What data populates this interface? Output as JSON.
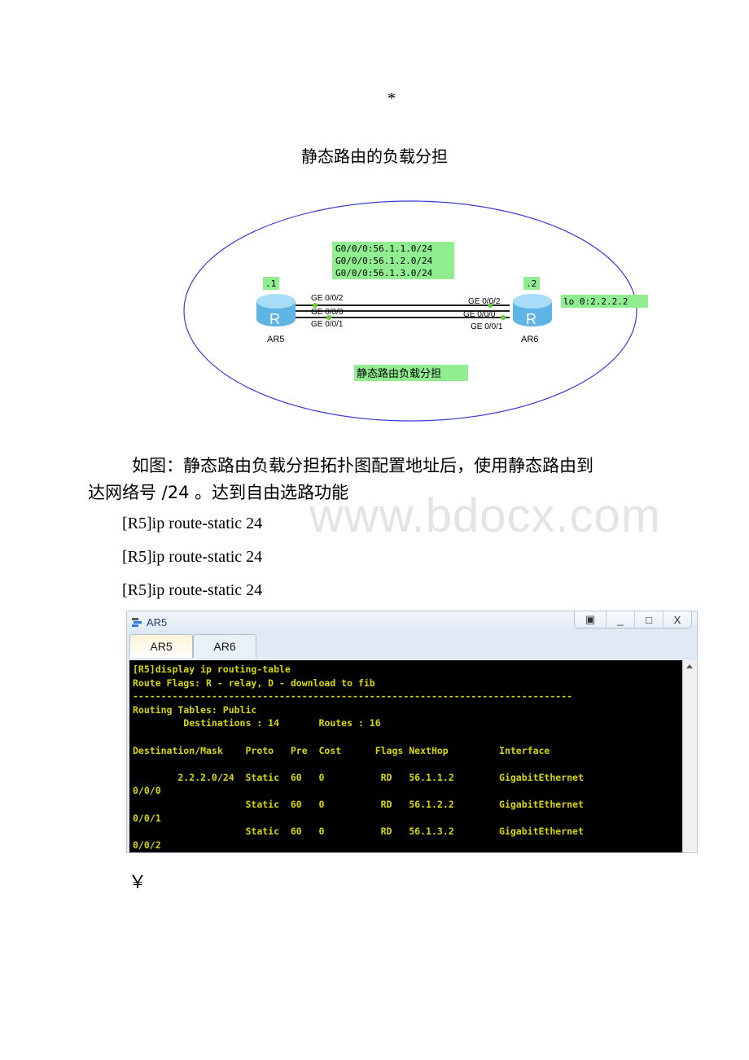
{
  "header": {
    "marker": "*",
    "title": "静态路由的负载分担"
  },
  "diagram": {
    "networks": [
      "G0/0/0:56.1.1.0/24",
      "G0/0/0:56.1.2.0/24",
      "G0/0/0:56.1.3.0/24"
    ],
    "left_router": {
      "name": "AR5",
      "addr": ".1",
      "ports": [
        "GE 0/0/2",
        "GE 0/0/0",
        "GE 0/0/1"
      ]
    },
    "right_router": {
      "name": "AR6",
      "addr": ".2",
      "ports": [
        "GE 0/0/2",
        "GE 0/0/0",
        "GE 0/0/1"
      ],
      "loopback": "lo 0:2.2.2.2"
    },
    "caption": "静态路由负载分担",
    "colors": {
      "label_bg": "#90ee90",
      "ellipse": "#3b3bd6",
      "link_dot": "#66cc33",
      "router": "#7ec8f0"
    }
  },
  "body": {
    "paragraph_line1": "如图：静态路由负载分担拓扑图配置地址后，使用静态路由到",
    "paragraph_line2": "达网络号 /24 。达到自由选路功能",
    "watermark": "www.bdocx.com",
    "commands": [
      "[R5]ip route-static 24",
      "[R5]ip route-static 24",
      "[R5]ip route-static 24"
    ]
  },
  "window": {
    "title": "AR5",
    "buttons": {
      "restore": "▣",
      "minimize": "_",
      "maximize": "□",
      "close": "X"
    },
    "tabs": [
      {
        "label": "AR5",
        "active": true
      },
      {
        "label": "AR6",
        "active": false
      }
    ],
    "terminal": {
      "text_color": "#d8d800",
      "lines": [
        "[R5]display ip routing-table",
        "Route Flags: R - relay, D - download to fib",
        "------------------------------------------------------------------------------",
        "Routing Tables: Public",
        "         Destinations : 14       Routes : 16",
        "",
        "Destination/Mask    Proto   Pre  Cost      Flags NextHop         Interface",
        "",
        "        2.2.2.0/24  Static  60   0          RD   56.1.1.2        GigabitEthernet",
        "0/0/0",
        "                    Static  60   0          RD   56.1.2.2        GigabitEthernet",
        "0/0/1",
        "                    Static  60   0          RD   56.1.3.2        GigabitEthernet",
        "0/0/2"
      ]
    }
  },
  "footer": {
    "symbol": "￥"
  }
}
